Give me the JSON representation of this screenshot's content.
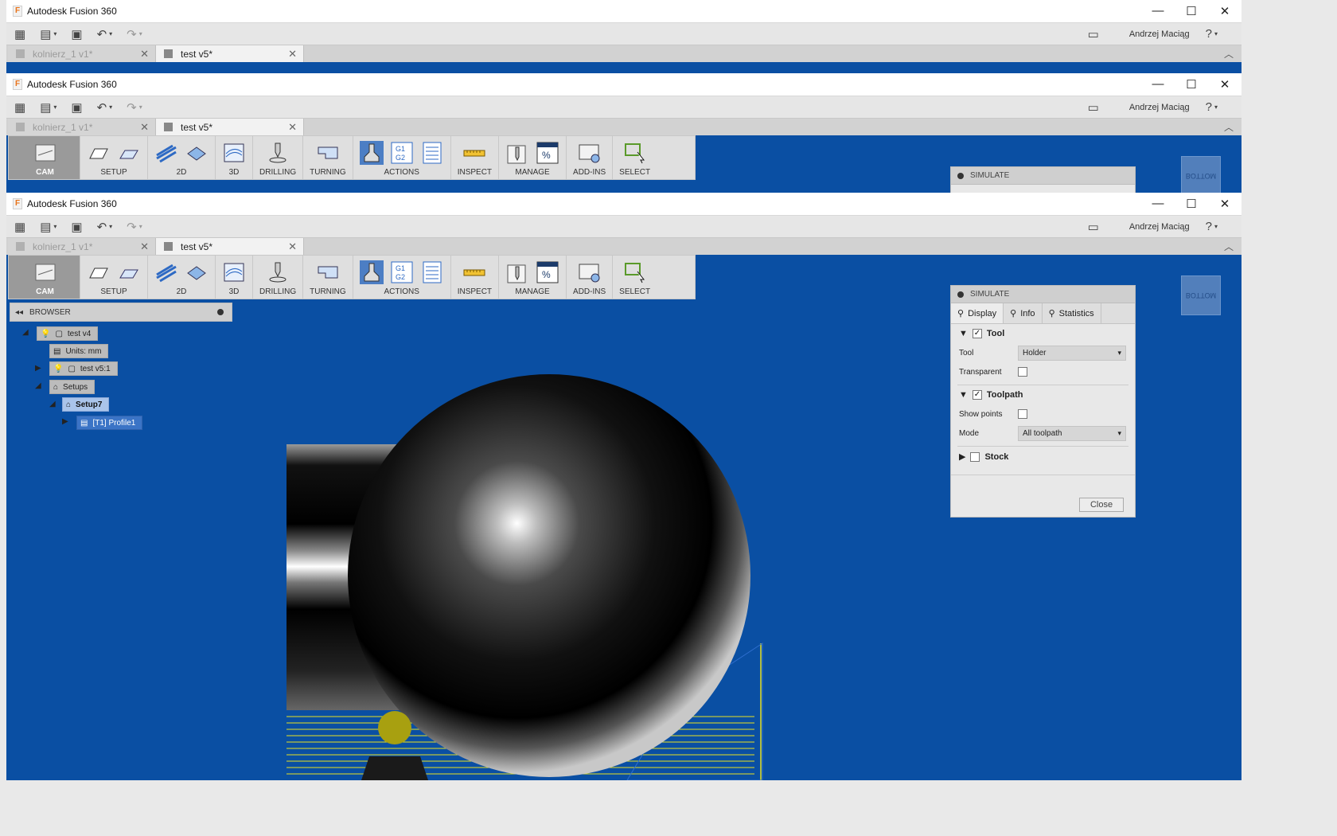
{
  "app": {
    "title": "Autodesk Fusion 360",
    "user": "Andrzej Maciąg"
  },
  "tabs": [
    {
      "label": "kolnierz_1 v1*"
    },
    {
      "label": "test v5*"
    }
  ],
  "toolbar": {
    "cam": "CAM",
    "setup": "SETUP",
    "t2d": "2D",
    "t3d": "3D",
    "drilling": "DRILLING",
    "turning": "TURNING",
    "actions": "ACTIONS",
    "inspect": "INSPECT",
    "manage": "MANAGE",
    "addins": "ADD-INS",
    "select": "SELECT",
    "g1g2": "G1\nG2"
  },
  "browser": {
    "title": "BROWSER",
    "nodes": {
      "root": "test v4",
      "units": "Units: mm",
      "body": "test v5:1",
      "setups": "Setups",
      "setup7": "Setup7",
      "profile": "[T1] Profile1"
    }
  },
  "simulate": {
    "title": "SIMULATE",
    "tabs": {
      "display": "Display",
      "info": "Info",
      "statistics": "Statistics"
    },
    "tool_section": "Tool",
    "tool_label": "Tool",
    "tool_value": "Holder",
    "transparent_label": "Transparent",
    "toolpath_section": "Toolpath",
    "show_points_label": "Show points",
    "mode_label": "Mode",
    "mode_value": "All toolpath",
    "stock_section": "Stock",
    "close": "Close"
  },
  "viewcube": {
    "label": "BOTTOM"
  },
  "colors": {
    "viewport": "#0a4fa3",
    "toolpath": "#e8e020",
    "accent": "#3b74c6"
  }
}
